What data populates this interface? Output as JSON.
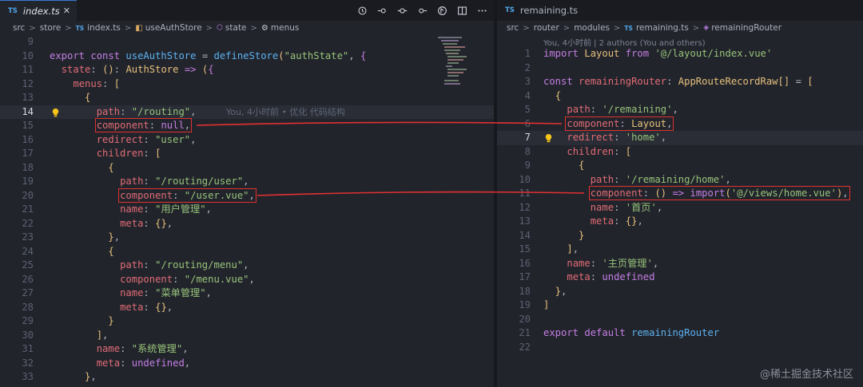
{
  "left": {
    "tab": {
      "badge": "TS",
      "name": "index.ts",
      "close": "✕"
    },
    "breadcrumb": {
      "items": [
        "src",
        "store",
        "index.ts",
        "useAuthStore",
        "state",
        "menus"
      ],
      "separator": ">"
    },
    "toolbar_icons": [
      "history-icon",
      "go-back-icon",
      "circle-dot-icon",
      "go-forward-icon",
      "git-compare-icon",
      "split-editor-icon",
      "more-actions-icon"
    ],
    "blame_inline": "You, 4小时前 • 优化 代码结构",
    "lines": [
      {
        "n": "9",
        "t": ""
      },
      {
        "n": "10",
        "t": "export const useAuthStore = defineStore(\"authState\", {"
      },
      {
        "n": "11",
        "t": "  state: (): AuthStore => ({"
      },
      {
        "n": "12",
        "t": "    menus: ["
      },
      {
        "n": "13",
        "t": "      {"
      },
      {
        "n": "14",
        "t": "        path: \"/routing\","
      },
      {
        "n": "15",
        "t": "        component: null,"
      },
      {
        "n": "16",
        "t": "        redirect: \"user\","
      },
      {
        "n": "17",
        "t": "        children: ["
      },
      {
        "n": "18",
        "t": "          {"
      },
      {
        "n": "19",
        "t": "            path: \"/routing/user\","
      },
      {
        "n": "20",
        "t": "            component: \"/user.vue\","
      },
      {
        "n": "21",
        "t": "            name: \"用户管理\","
      },
      {
        "n": "22",
        "t": "            meta: {},"
      },
      {
        "n": "23",
        "t": "          },"
      },
      {
        "n": "24",
        "t": "          {"
      },
      {
        "n": "25",
        "t": "            path: \"/routing/menu\","
      },
      {
        "n": "26",
        "t": "            component: \"/menu.vue\","
      },
      {
        "n": "27",
        "t": "            name: \"菜单管理\","
      },
      {
        "n": "28",
        "t": "            meta: {},"
      },
      {
        "n": "29",
        "t": "          }"
      },
      {
        "n": "30",
        "t": "        ],"
      },
      {
        "n": "31",
        "t": "        name: \"系统管理\","
      },
      {
        "n": "32",
        "t": "        meta: undefined,"
      },
      {
        "n": "33",
        "t": "      },"
      }
    ]
  },
  "right": {
    "tab": {
      "badge": "TS",
      "name": "remaining.ts"
    },
    "breadcrumb": {
      "items": [
        "src",
        "router",
        "modules",
        "remaining.ts",
        "remainingRouter"
      ],
      "separator": ">"
    },
    "blame_header": "You, 4小时前 | 2 authors (You and others)",
    "lines": [
      {
        "n": "1",
        "t": "import Layout from '@/layout/index.vue'"
      },
      {
        "n": "2",
        "t": ""
      },
      {
        "n": "3",
        "t": "const remainingRouter: AppRouteRecordRaw[] = ["
      },
      {
        "n": "4",
        "t": "  {"
      },
      {
        "n": "5",
        "t": "    path: '/remaining',"
      },
      {
        "n": "6",
        "t": "    component: Layout,"
      },
      {
        "n": "7",
        "t": "    redirect: 'home',"
      },
      {
        "n": "8",
        "t": "    children: ["
      },
      {
        "n": "9",
        "t": "      {"
      },
      {
        "n": "10",
        "t": "        path: '/remaining/home',"
      },
      {
        "n": "11",
        "t": "        component: () => import('@/views/home.vue'),"
      },
      {
        "n": "12",
        "t": "        name: '首页',"
      },
      {
        "n": "13",
        "t": "        meta: {},"
      },
      {
        "n": "14",
        "t": "      }"
      },
      {
        "n": "15",
        "t": "    ],"
      },
      {
        "n": "16",
        "t": "    name: '主页管理',"
      },
      {
        "n": "17",
        "t": "    meta: undefined"
      },
      {
        "n": "18",
        "t": "  },"
      },
      {
        "n": "19",
        "t": "]"
      },
      {
        "n": "20",
        "t": ""
      },
      {
        "n": "21",
        "t": "export default remainingRouter"
      },
      {
        "n": "22",
        "t": ""
      }
    ]
  },
  "watermark": "@稀土掘金技术社区",
  "colors": {
    "annotation_red": "#e03131",
    "ts_badge": "#4fa6e8",
    "keyword": "#c47fe3",
    "function": "#5bb2f0",
    "string": "#97c379",
    "property": "#e06c75",
    "type": "#e5c07b"
  }
}
